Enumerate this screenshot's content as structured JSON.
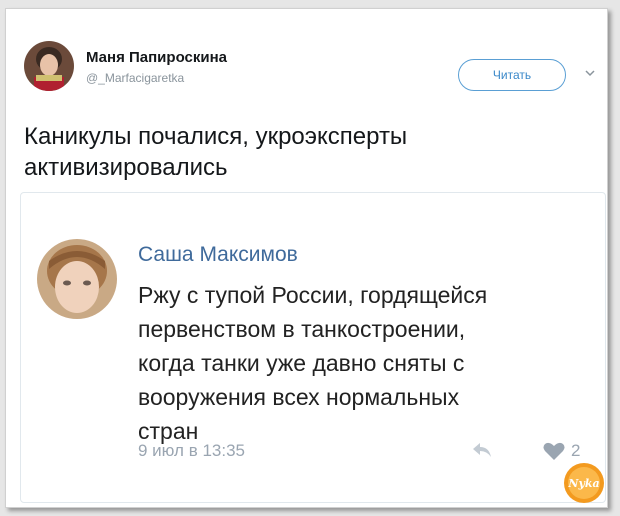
{
  "tweet": {
    "author_name": "Маня Папироскина",
    "author_handle": "@_Marfacigaretka",
    "follow_label": "Читать",
    "text_line1": "Каникулы почалися, укроэксперты",
    "text_line2": "активизировались"
  },
  "quote": {
    "name": "Саша Максимов",
    "lines": [
      "Ржу с тупой России, гордящейся",
      "первенством в танкостроении,",
      "когда танки уже давно сняты с",
      "вооружения всех нормальных",
      "стран"
    ],
    "date": "9 июл в 13:35",
    "likes": "2"
  },
  "watermark": {
    "text": "Nyka"
  },
  "colors": {
    "follow_accent": "#3a88c9",
    "quote_name": "#3f6a9b",
    "meta_gray": "#9aa5b1",
    "watermark_orange": "#f39a1f"
  },
  "icons": {
    "more": "chevron-down-icon",
    "share": "share-arrow-icon",
    "like": "heart-icon"
  }
}
